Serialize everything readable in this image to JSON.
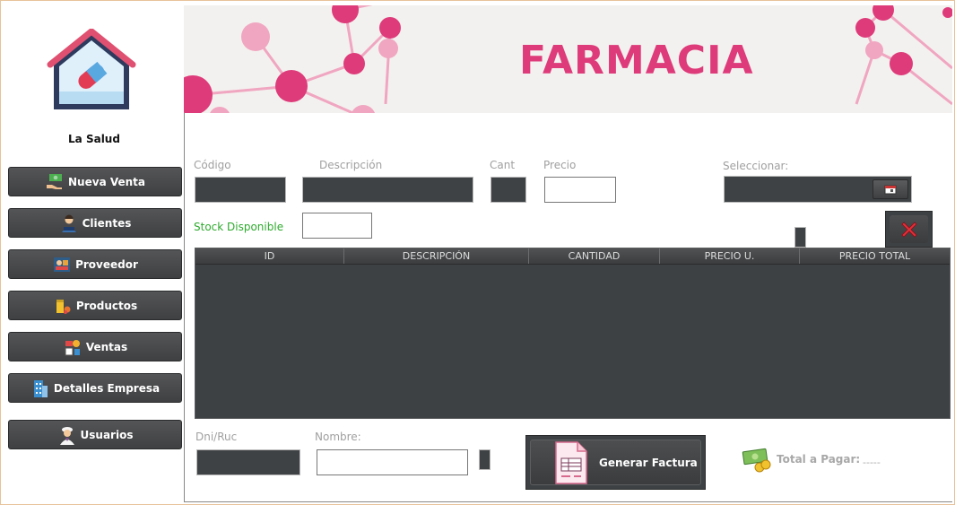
{
  "sidebar": {
    "brand": "La Salud",
    "items": [
      {
        "label": "Nueva Venta",
        "icon": "money-hand-icon"
      },
      {
        "label": "Clientes",
        "icon": "client-icon"
      },
      {
        "label": "Proveedor",
        "icon": "supplier-icon"
      },
      {
        "label": "Productos",
        "icon": "products-icon"
      },
      {
        "label": "Ventas",
        "icon": "sales-icon"
      },
      {
        "label": "Detalles Empresa",
        "icon": "building-icon"
      },
      {
        "label": "Usuarios",
        "icon": "user-icon"
      }
    ]
  },
  "header": {
    "title": "FARMACIA",
    "accent": "#de3b7a"
  },
  "form": {
    "codigo_label": "Código",
    "descripcion_label": "Descripción",
    "cant_label": "Cant",
    "precio_label": "Precio",
    "seleccionar_label": "Seleccionar:",
    "stock_label": "Stock Disponible",
    "dni_label": "Dni/Ruc",
    "nombre_label": "Nombre:"
  },
  "table": {
    "columns": [
      "ID",
      "DESCRIPCIÓN",
      "CANTIDAD",
      "PRECIO U.",
      "PRECIO TOTAL"
    ],
    "rows": []
  },
  "actions": {
    "generar_factura": "Generar Factura"
  },
  "totals": {
    "label": "Total a Pagar:",
    "value": "-----"
  },
  "colors": {
    "stock_label": "#2eaa2e",
    "dark_field": "#3f4244",
    "delete_icon": "#e0303a"
  }
}
